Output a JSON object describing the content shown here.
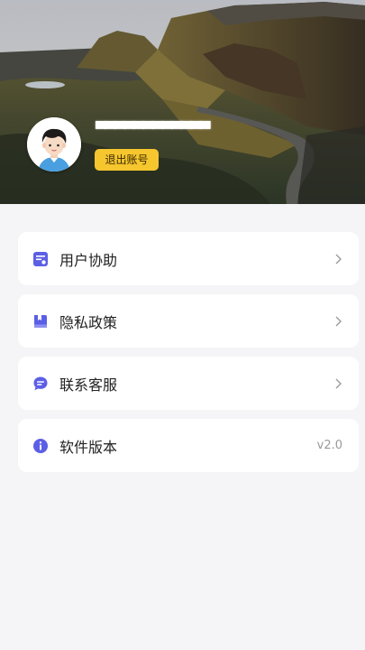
{
  "profile": {
    "username": "▀▀▀▀▀▀▀▀▀▀▀▀",
    "logout_label": "退出账号",
    "avatar_icon": "user-avatar-icon"
  },
  "menu": {
    "items": [
      {
        "label": "用户协助",
        "icon": "user-agreement-icon",
        "trailing": "chevron-right-icon"
      },
      {
        "label": "隐私政策",
        "icon": "privacy-book-icon",
        "trailing": "chevron-right-icon"
      },
      {
        "label": "联系客服",
        "icon": "chat-bubble-icon",
        "trailing": "chevron-right-icon"
      },
      {
        "label": "软件版本",
        "icon": "info-icon",
        "trailing_text": "v2.0"
      }
    ]
  },
  "colors": {
    "accent": "#5b5fe6",
    "logout_button": "#f6c62e",
    "background": "#f5f5f7"
  }
}
